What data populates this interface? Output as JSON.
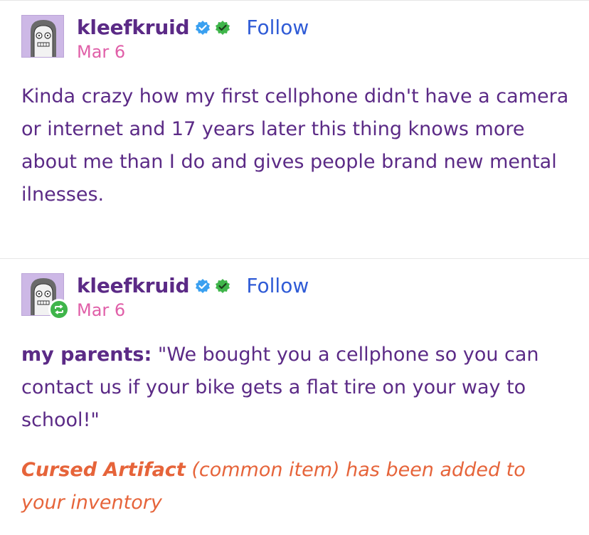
{
  "posts": [
    {
      "username": "kleefkruid",
      "follow_label": "Follow",
      "date": "Mar 6",
      "body": "Kinda crazy how my first cellphone didn't have a camera or internet and 17 years later this thing knows more about me than I do and gives people brand new mental ilnesses."
    },
    {
      "username": "kleefkruid",
      "follow_label": "Follow",
      "date": "Mar 6",
      "speaker": "my parents:",
      "quote": "\"We bought you a cellphone so you can contact us if your bike gets a flat tire on your way to school!\"",
      "cursed_name": "Cursed Artifact",
      "cursed_rest": "(common item) has been added to your inventory"
    }
  ],
  "colors": {
    "username": "#5b2a86",
    "date": "#e05fa8",
    "follow": "#2f5bd6",
    "body": "#5b2a86",
    "cursed": "#e6643a",
    "badge_blue": "#3aa0f0",
    "badge_green": "#3fb54a"
  },
  "icons": [
    "avatar",
    "verified-blue-badge-icon",
    "verified-green-badge-icon",
    "reblog-icon"
  ]
}
